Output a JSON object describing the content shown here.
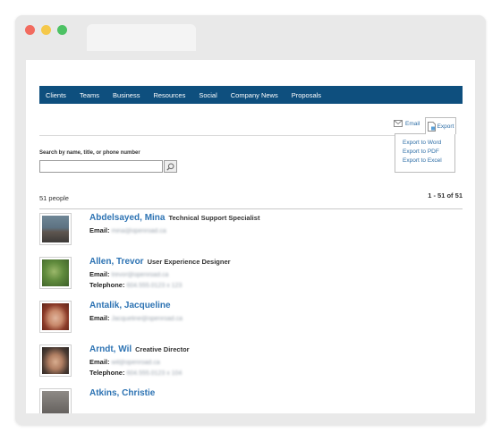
{
  "nav": {
    "items": [
      "Clients",
      "Teams",
      "Business",
      "Resources",
      "Social",
      "Company News",
      "Proposals"
    ]
  },
  "toolbar": {
    "email_label": "Email",
    "export_label": "Export",
    "export_options": [
      "Export to Word",
      "Export to PDF",
      "Export to Excel"
    ]
  },
  "search": {
    "label": "Search by name, title, or phone number",
    "value": "",
    "placeholder": ""
  },
  "results": {
    "count_text": "51 people",
    "pagination": "1 - 51 of 51"
  },
  "people": [
    {
      "name": "Abdelsayed, Mina",
      "title": "Technical Support Specialist",
      "email_label": "Email:",
      "email": "mina@openroad.ca",
      "telephone_label": "",
      "telephone": ""
    },
    {
      "name": "Allen, Trevor",
      "title": "User Experience Designer",
      "email_label": "Email:",
      "email": "trevor@openroad.ca",
      "telephone_label": "Telephone:",
      "telephone": "604.555.0123 x 123"
    },
    {
      "name": "Antalik, Jacqueline",
      "title": "",
      "email_label": "Email:",
      "email": "Jacqueline@openroad.ca",
      "telephone_label": "",
      "telephone": ""
    },
    {
      "name": "Arndt, Wil",
      "title": "Creative Director",
      "email_label": "Email:",
      "email": "wil@openroad.ca",
      "telephone_label": "Telephone:",
      "telephone": "604.555.0123 x 104"
    },
    {
      "name": "Atkins, Christie",
      "title": "",
      "email_label": "",
      "email": "",
      "telephone_label": "",
      "telephone": ""
    }
  ],
  "colors": {
    "nav_background": "#0e4f7e",
    "link_blue": "#2d73b3",
    "window_chrome": "#e9e9e9"
  },
  "icons": {
    "email": "email-icon",
    "export": "document-icon",
    "search": "magnifier-icon"
  }
}
